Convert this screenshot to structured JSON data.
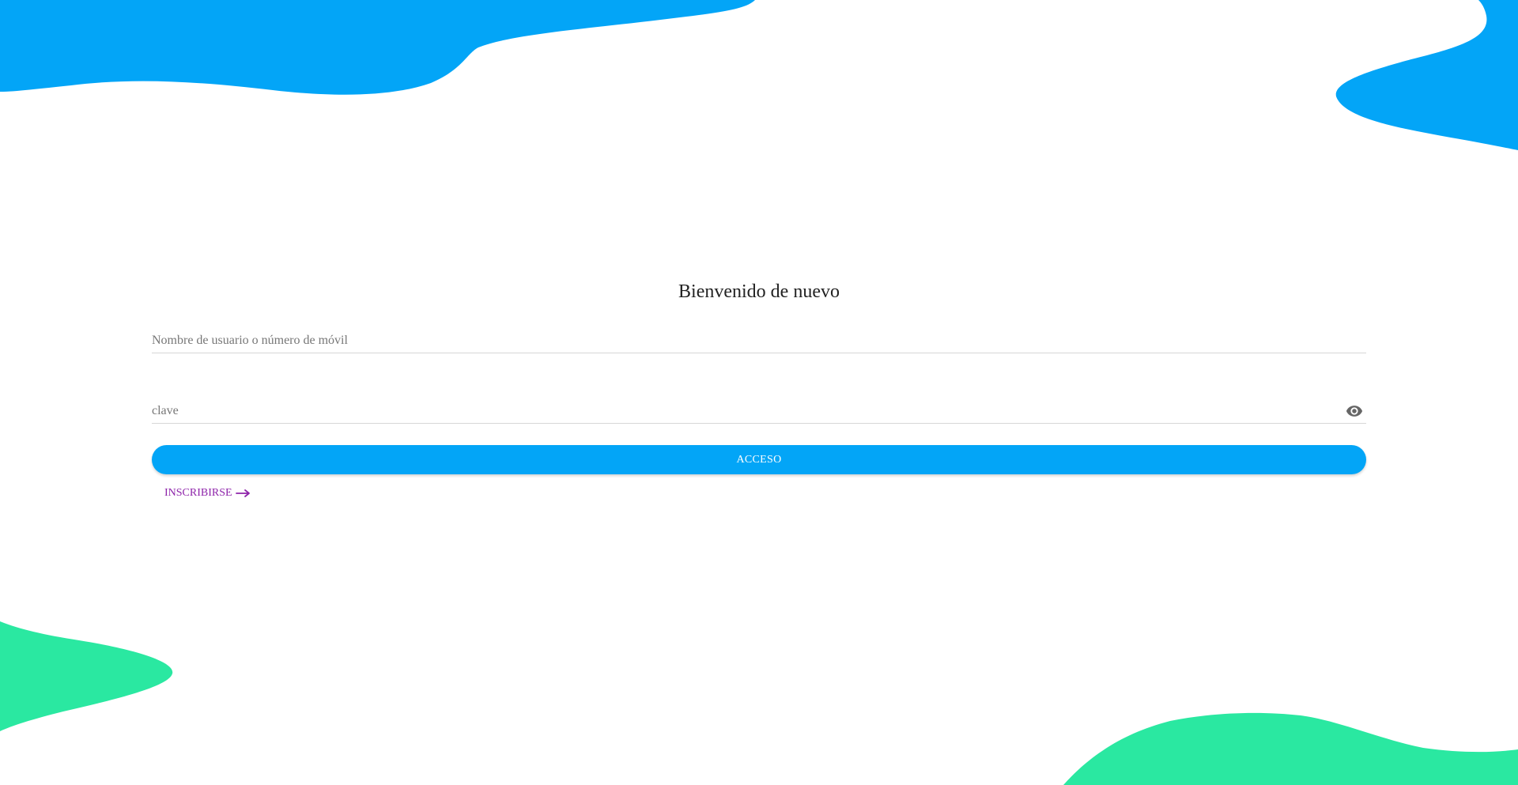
{
  "login": {
    "title": "Bienvenido de nuevo",
    "username_placeholder": "Nombre de usuario o número de móvil",
    "username_value": "",
    "password_placeholder": "clave",
    "password_value": "",
    "submit_label": "ACCESO",
    "signup_label": "INSCRIBIRSE"
  },
  "icons": {
    "password_toggle": "eye-icon",
    "signup_arrow": "arrow-right-icon"
  },
  "colors": {
    "primary_blue": "#03a5f7",
    "accent_green": "#2ae8a1",
    "link_purple": "#8e24aa"
  }
}
